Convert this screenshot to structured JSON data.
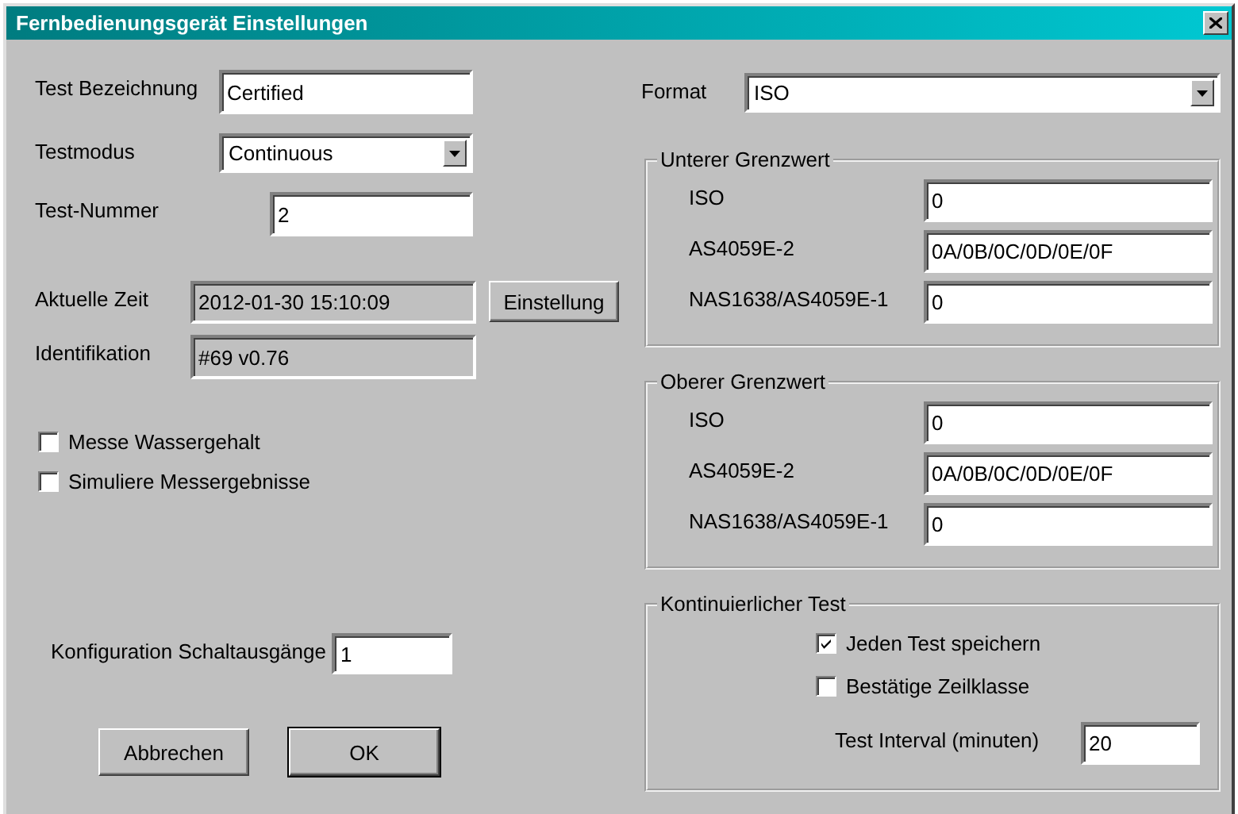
{
  "window": {
    "title": "Fernbedienungsgerät Einstellungen"
  },
  "fields": [
    {
      "kind": "text",
      "label": "Test Bezeichnung",
      "value": "Certified"
    },
    {
      "kind": "combo",
      "label": "Testmodus",
      "value": "Continuous"
    },
    {
      "kind": "text",
      "label": "Test-Nummer",
      "value": "2"
    },
    {
      "kind": "readonly",
      "label": "Aktuelle Zeit",
      "value": "2012-01-30 15:10:09",
      "button": "Einstellung"
    },
    {
      "kind": "readonly",
      "label": "Identifikation",
      "value": "#69 v0.76"
    }
  ],
  "options": [
    {
      "label": "Messe Wassergehalt",
      "checked": false
    },
    {
      "label": "Simuliere Messergebnisse",
      "checked": false
    }
  ],
  "output_config": {
    "label": "Konfiguration Schaltausgänge",
    "value": "1"
  },
  "buttons": [
    {
      "label": "Abbrechen",
      "default": false
    },
    {
      "label": "OK",
      "default": true
    }
  ],
  "format": {
    "label": "Format",
    "value": "ISO"
  },
  "limits": [
    {
      "title": "Unterer Grenzwert",
      "rows": [
        {
          "label": "ISO",
          "value": "0"
        },
        {
          "label": "AS4059E-2",
          "value": "0A/0B/0C/0D/0E/0F"
        },
        {
          "label": "NAS1638/AS4059E-1",
          "value": "0"
        }
      ]
    },
    {
      "title": "Oberer Grenzwert",
      "rows": [
        {
          "label": "ISO",
          "value": "0"
        },
        {
          "label": "AS4059E-2",
          "value": "0A/0B/0C/0D/0E/0F"
        },
        {
          "label": "NAS1638/AS4059E-1",
          "value": "0"
        }
      ]
    }
  ],
  "continuous_test": {
    "title": "Kontinuierlicher Test",
    "options": [
      {
        "label": "Jeden Test speichern",
        "checked": true
      },
      {
        "label": "Bestätige Zeilklasse",
        "checked": false
      }
    ],
    "interval": {
      "label": "Test Interval (minuten)",
      "value": "20"
    }
  }
}
